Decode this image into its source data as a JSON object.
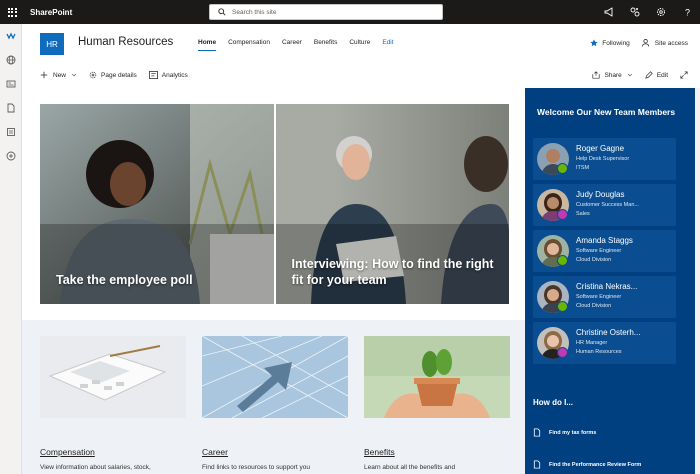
{
  "suite": {
    "brand": "SharePoint",
    "search_placeholder": "Search this site",
    "icons": [
      "megaphone-icon",
      "share-network-icon",
      "settings-icon",
      "help-icon"
    ]
  },
  "appbar": {
    "icons": [
      "sharepoint-logo-icon",
      "globe-icon",
      "news-icon",
      "document-icon",
      "list-icon",
      "add-circle-icon"
    ]
  },
  "site": {
    "logo_text": "HR",
    "title": "Human Resources",
    "nav": [
      "Home",
      "Compensation",
      "Career",
      "Benefits",
      "Culture",
      "Edit"
    ],
    "following": "Following",
    "site_access": "Site access"
  },
  "commandbar": {
    "new": "New",
    "page_details": "Page details",
    "analytics": "Analytics",
    "share": "Share",
    "edit": "Edit"
  },
  "hero": {
    "tiles": [
      {
        "caption": "Take the employee poll"
      },
      {
        "caption": "Interviewing: How to find the right fit for your team"
      }
    ]
  },
  "cards": [
    {
      "title": "Compensation",
      "desc": "View information about salaries, stock,"
    },
    {
      "title": "Career",
      "desc": "Find links to resources to support you"
    },
    {
      "title": "Benefits",
      "desc": "Learn about all the benefits and"
    }
  ],
  "panel": {
    "heading": "Welcome Our New Team Members",
    "people": [
      {
        "name": "Roger Gagne",
        "role": "Help Desk Supervisor",
        "dept": "ITSM",
        "status_color": "#6bb700"
      },
      {
        "name": "Judy Douglas",
        "role": "Customer Success Man...",
        "dept": "Sales",
        "status_color": "#c239b3"
      },
      {
        "name": "Amanda Staggs",
        "role": "Software Engineer",
        "dept": "Cloud Division",
        "status_color": "#6bb700"
      },
      {
        "name": "Cristina Nekras...",
        "role": "Software Engineer",
        "dept": "Cloud Division",
        "status_color": "#6bb700"
      },
      {
        "name": "Christine Osterh...",
        "role": "HR Manager",
        "dept": "Human Resources",
        "status_color": "#c239b3"
      }
    ],
    "howdo": "How do I...",
    "links": [
      "Find my tax forms",
      "Find the Performance Review Form"
    ]
  },
  "colors": {
    "accent": "#0f6cbd",
    "panel": "#003f80",
    "suitebar": "#1b1a19"
  }
}
